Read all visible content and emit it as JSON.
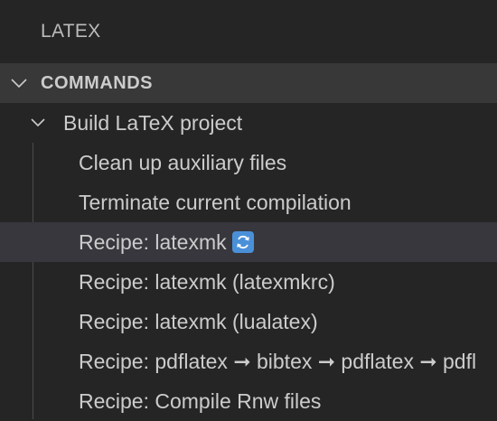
{
  "panel": {
    "title": "LATEX"
  },
  "section": {
    "title": "COMMANDS",
    "expanded": true
  },
  "tree": {
    "parent": {
      "label": "Build LaTeX project",
      "expanded": true
    },
    "children": [
      {
        "label": "Clean up auxiliary files"
      },
      {
        "label": "Terminate current compilation"
      },
      {
        "label": "Recipe: latexmk",
        "icon": "refresh-icon",
        "selected": true
      },
      {
        "label": "Recipe: latexmk (latexmkrc)"
      },
      {
        "label": "Recipe: latexmk (lualatex)"
      },
      {
        "label": "Recipe: pdflatex ➞ bibtex ➞ pdflatex ➞ pdflatex"
      },
      {
        "label": "Recipe: Compile Rnw files"
      }
    ]
  },
  "colors": {
    "background": "#252526",
    "section_header": "#383838",
    "selected_row": "#37373d",
    "text": "#cccccc",
    "icon_accent": "#4a90d9"
  }
}
